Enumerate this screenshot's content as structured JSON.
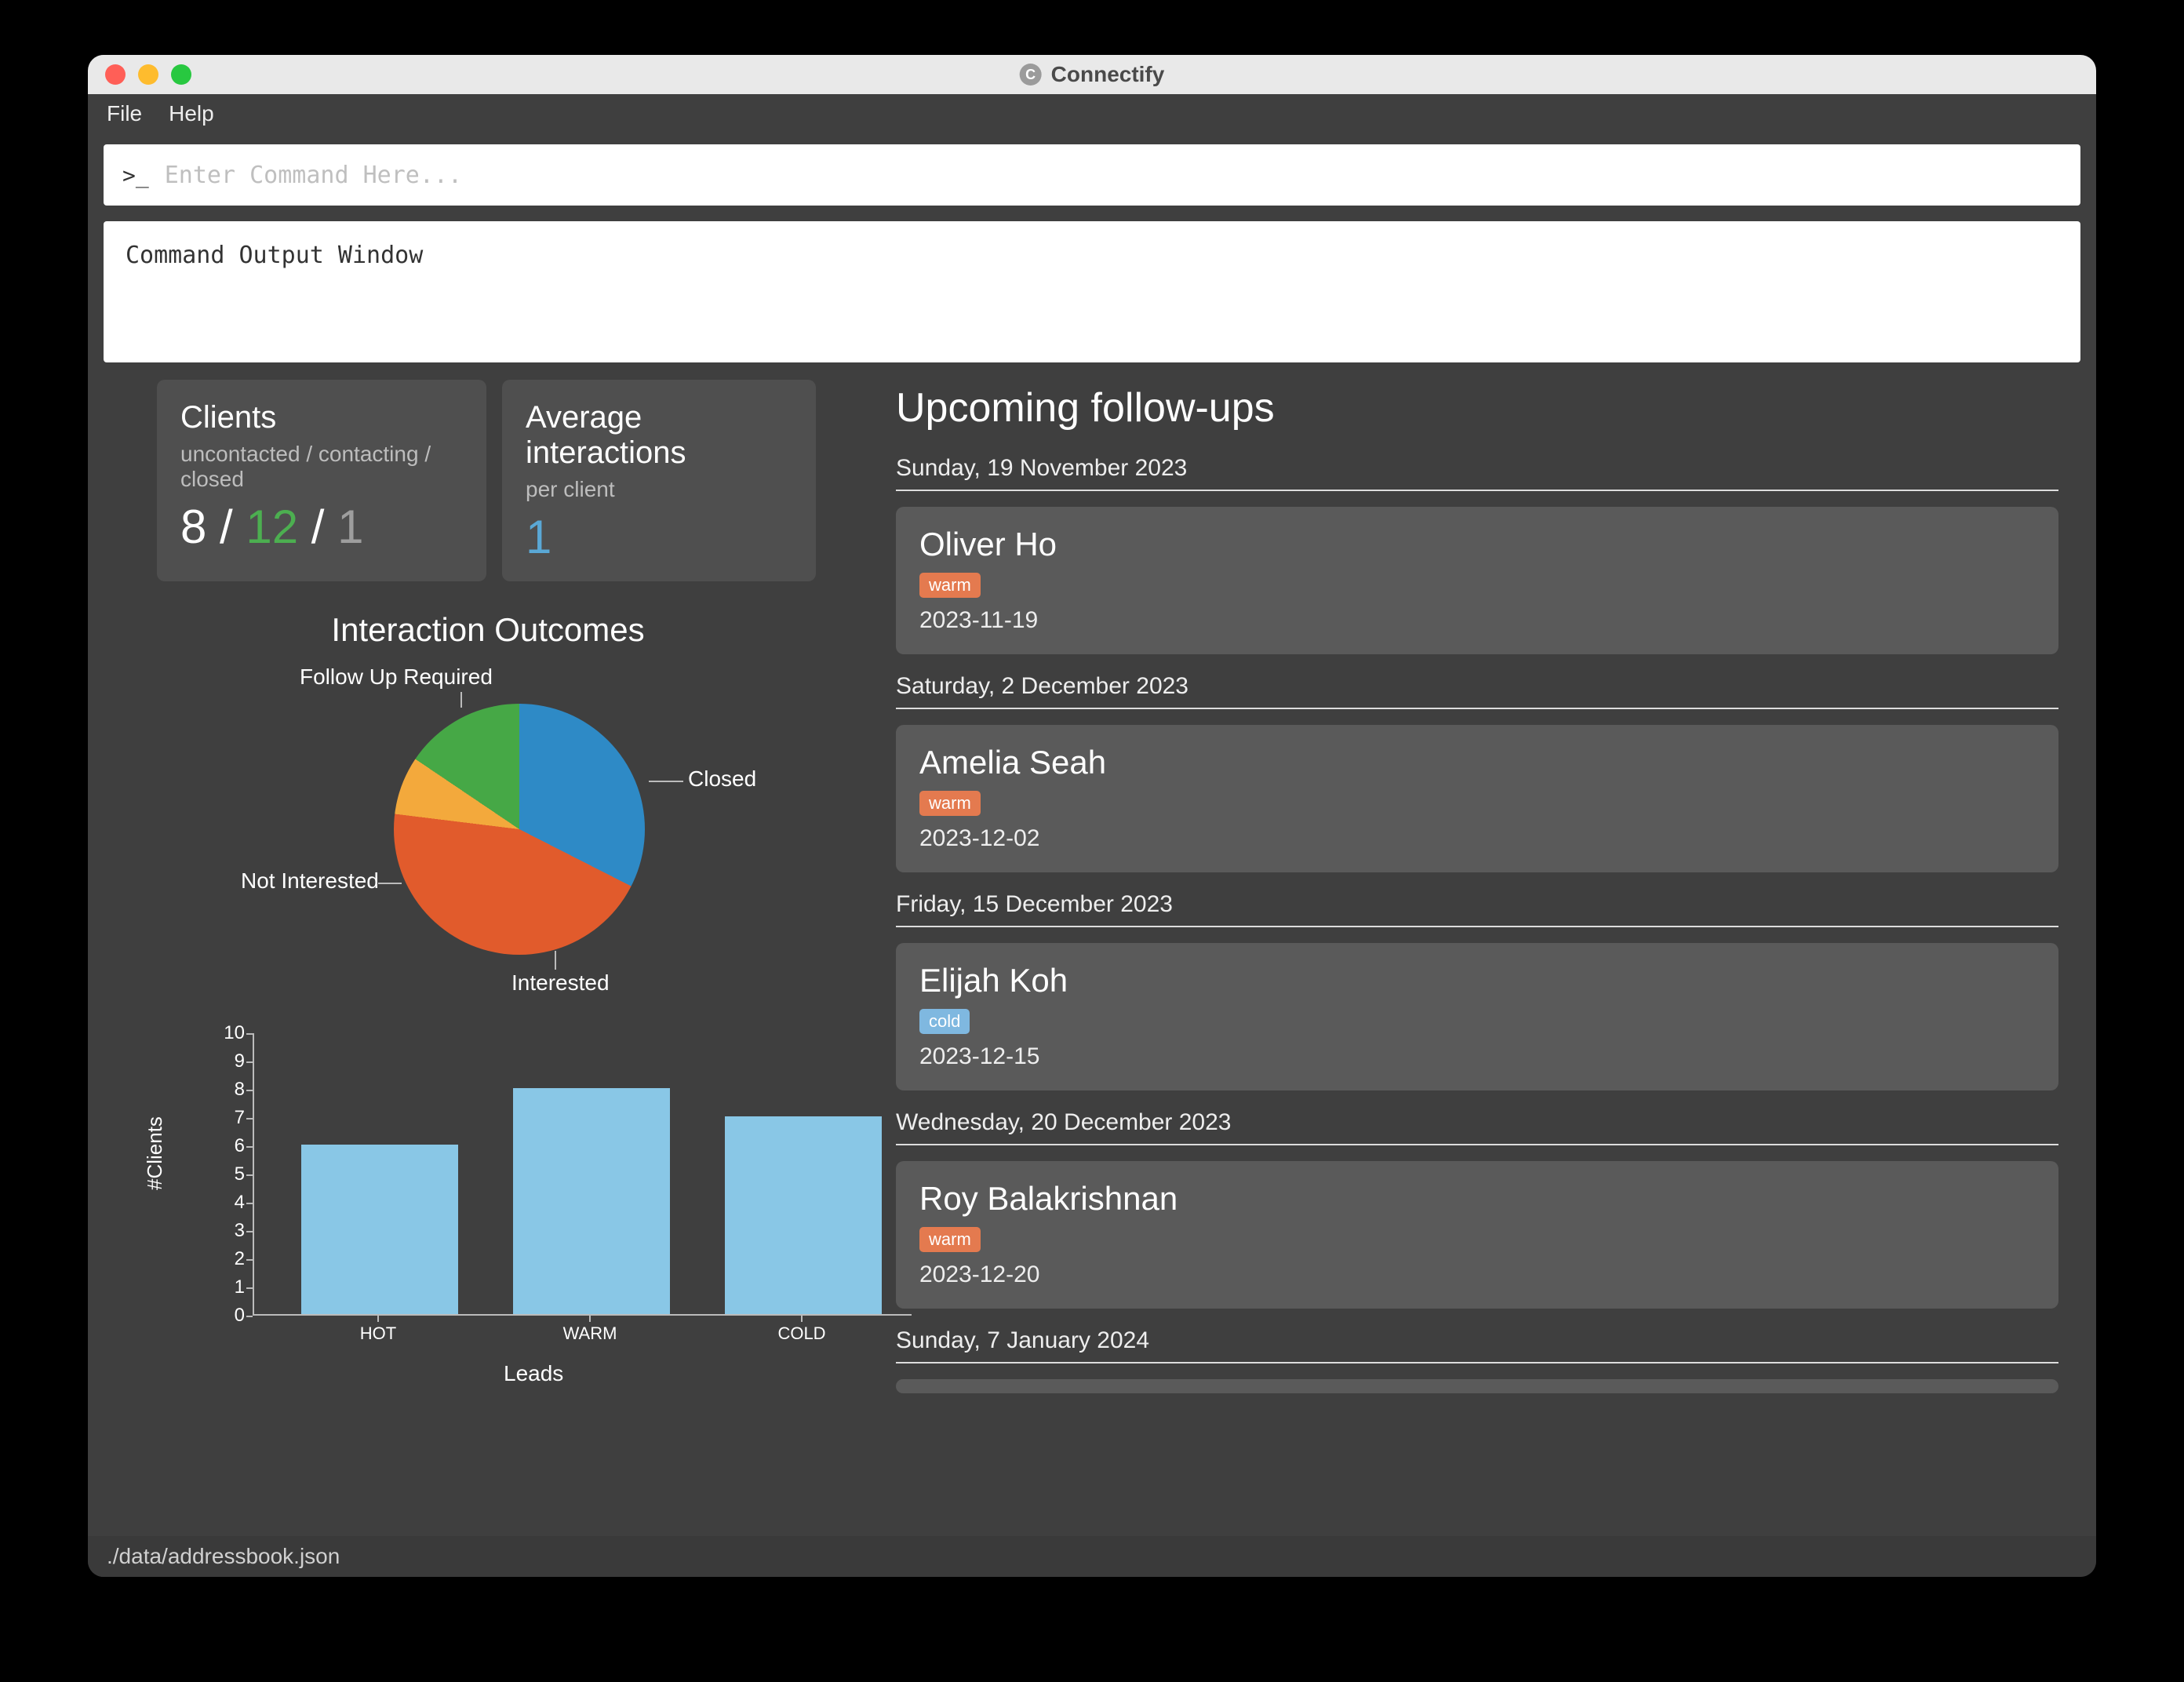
{
  "app": {
    "title": "Connectify"
  },
  "menu": {
    "file": "File",
    "help": "Help"
  },
  "command": {
    "placeholder": "Enter Command Here...",
    "output": "Command Output Window"
  },
  "stats": {
    "clients": {
      "title": "Clients",
      "subtitle": "uncontacted / contacting / closed",
      "uncontacted": "8",
      "contacting": "12",
      "closed": "1",
      "slash": " / "
    },
    "avg": {
      "title": "Average interactions",
      "subtitle": "per client",
      "value": "1"
    }
  },
  "pie_section_title": "Interaction Outcomes",
  "pie_labels": {
    "follow_up": "Follow Up Required",
    "closed": "Closed",
    "interested": "Interested",
    "not_interested": "Not Interested"
  },
  "bar_labels": {
    "y": "#Clients",
    "x": "Leads"
  },
  "followups": {
    "title": "Upcoming follow-ups",
    "groups": [
      {
        "header": "Sunday, 19 November 2023",
        "items": [
          {
            "name": "Oliver Ho",
            "tag": "warm",
            "date": "2023-11-19"
          }
        ]
      },
      {
        "header": "Saturday, 2 December 2023",
        "items": [
          {
            "name": "Amelia Seah",
            "tag": "warm",
            "date": "2023-12-02"
          }
        ]
      },
      {
        "header": "Friday, 15 December 2023",
        "items": [
          {
            "name": "Elijah Koh",
            "tag": "cold",
            "date": "2023-12-15"
          }
        ]
      },
      {
        "header": "Wednesday, 20 December 2023",
        "items": [
          {
            "name": "Roy Balakrishnan",
            "tag": "warm",
            "date": "2023-12-20"
          }
        ]
      },
      {
        "header": "Sunday, 7 January 2024",
        "items": []
      }
    ]
  },
  "footer": {
    "path": "./data/addressbook.json"
  },
  "chart_data": [
    {
      "type": "pie",
      "title": "Interaction Outcomes",
      "categories": [
        "Follow Up Required",
        "Closed",
        "Interested",
        "Not Interested"
      ],
      "values": [
        40,
        8,
        44,
        8
      ]
    },
    {
      "type": "bar",
      "title": "",
      "xlabel": "Leads",
      "ylabel": "#Clients",
      "ylim": [
        0,
        10
      ],
      "yticks": [
        0,
        1,
        2,
        3,
        4,
        5,
        6,
        7,
        8,
        9,
        10
      ],
      "categories": [
        "HOT",
        "WARM",
        "COLD"
      ],
      "values": [
        6,
        8,
        7
      ]
    }
  ]
}
